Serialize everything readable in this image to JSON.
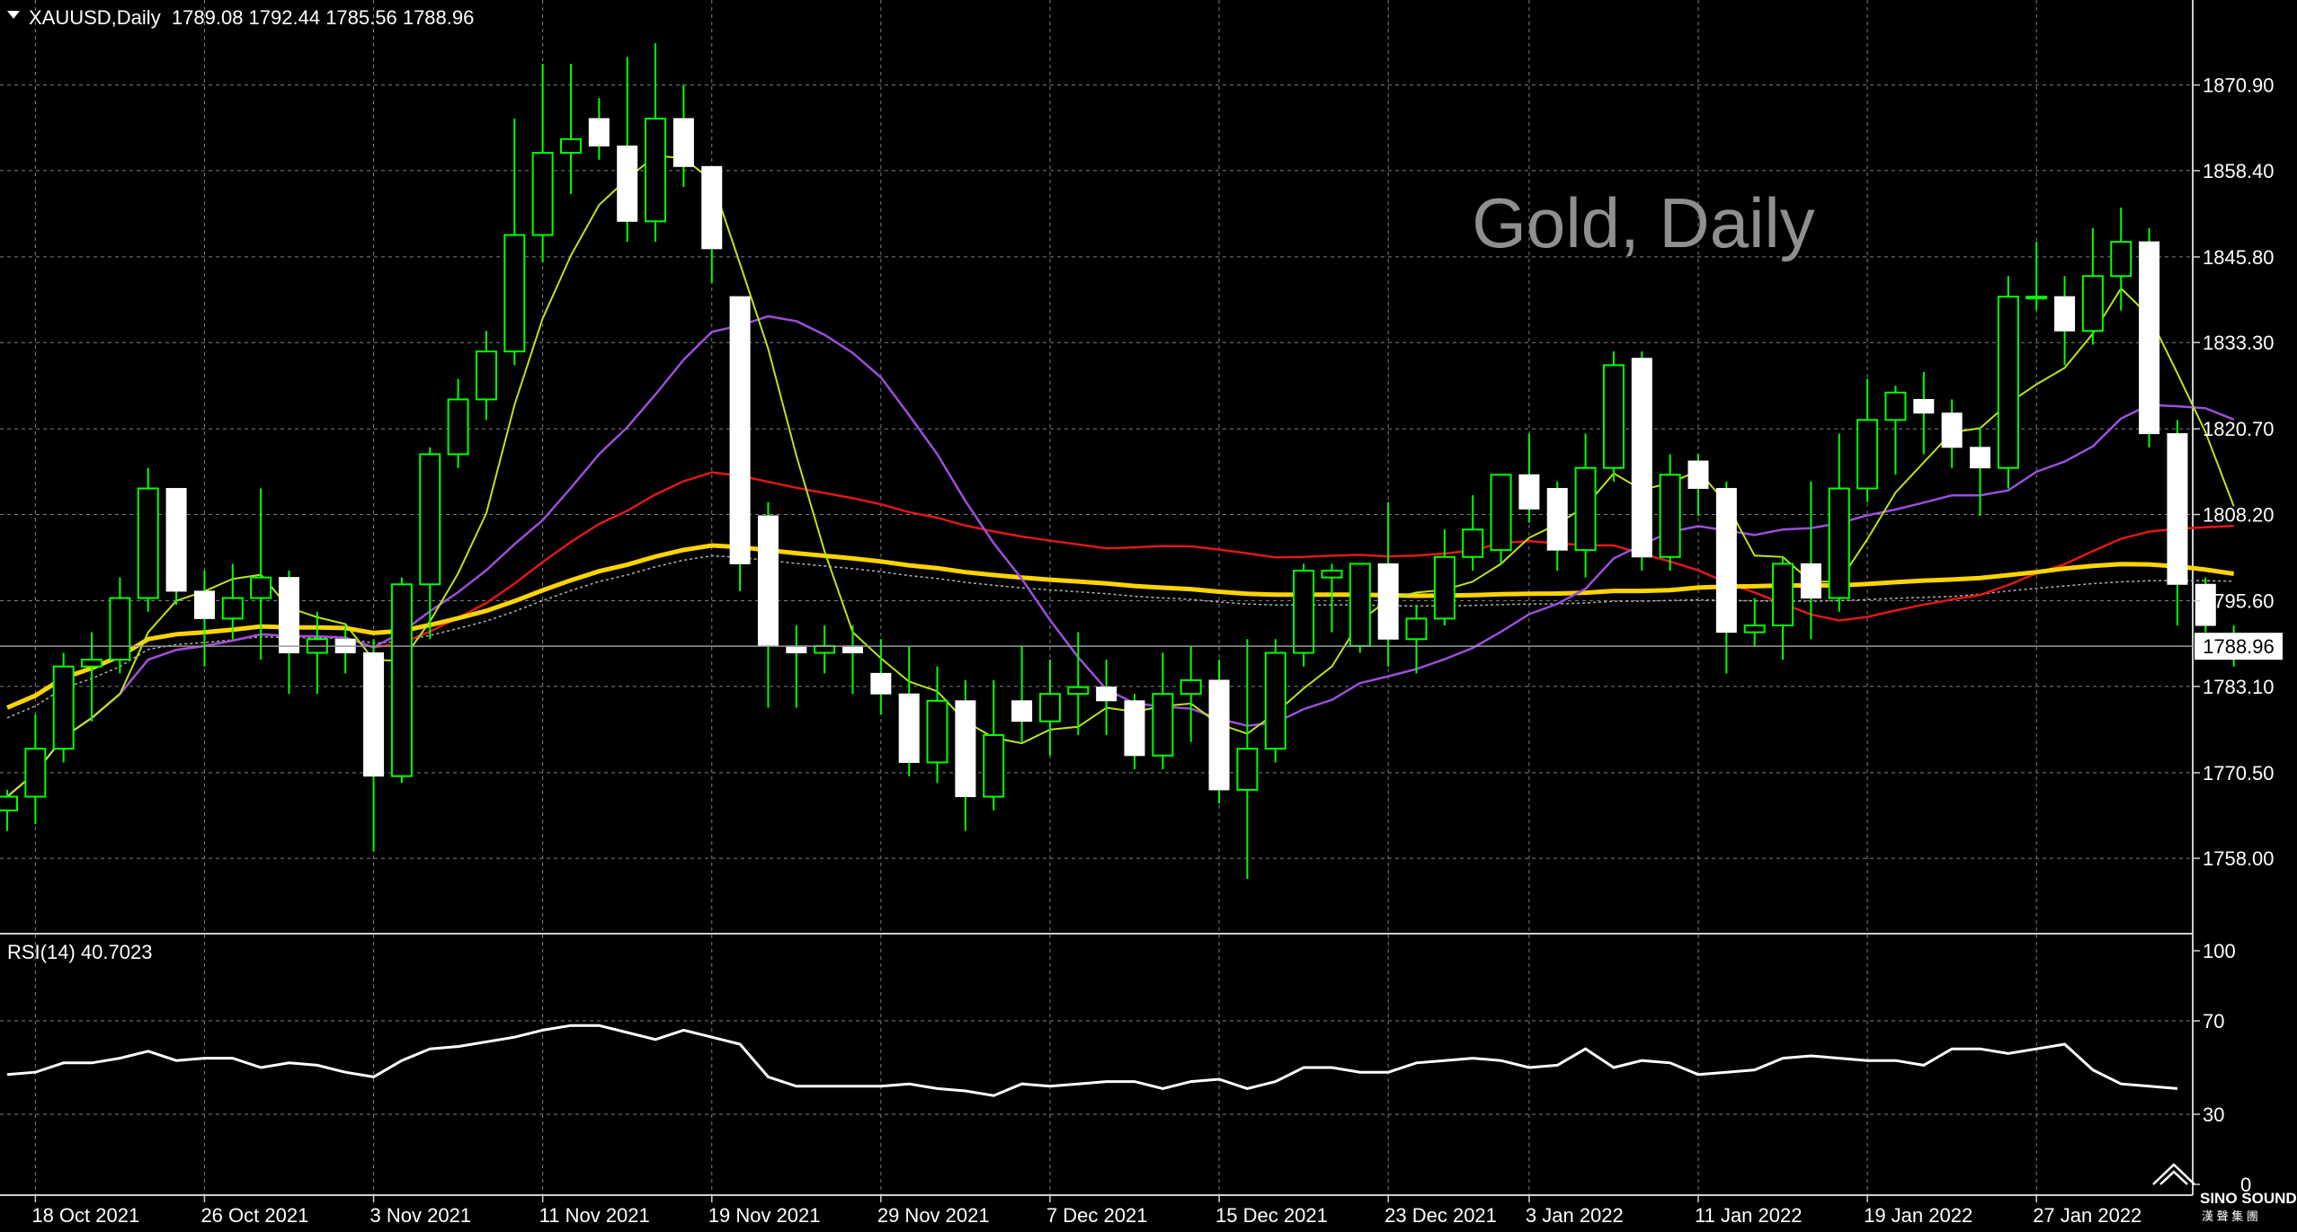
{
  "header": {
    "symbol_line": "XAUUSD,Daily  1789.08 1792.44 1785.56 1788.96",
    "watermark": "Gold, Daily"
  },
  "price_label": "1788.96",
  "rsi_label": "RSI(14) 40.7023",
  "logo": {
    "line1": "SINO SOUND",
    "line2": "漢 聲 集 團"
  },
  "colors": {
    "background": "#000000",
    "grid": "#7f7f7f",
    "bull_candle": "#00ff00",
    "bear_candle": "#ffffff",
    "ma_fast": "#b7e51f",
    "ma_mid": "#9b4fdb",
    "ma_red": "#e01818",
    "ma_yellow": "#ffd400",
    "ma_grey": "#b0b0b0",
    "rsi_line": "#ffffff"
  },
  "chart_data": {
    "type": "candlestick",
    "symbol": "XAUUSD",
    "timeframe": "Daily",
    "last_ohlc": {
      "open": 1789.08,
      "high": 1792.44,
      "low": 1785.56,
      "close": 1788.96
    },
    "ylim": [
      1747.0,
      1882.0
    ],
    "y_ticks": [
      1758.0,
      1770.5,
      1783.1,
      1795.6,
      1808.2,
      1820.7,
      1833.3,
      1845.8,
      1858.4,
      1870.9
    ],
    "x_ticks": [
      {
        "label": "18 Oct 2021",
        "index": 1
      },
      {
        "label": "26 Oct 2021",
        "index": 7
      },
      {
        "label": "3 Nov 2021",
        "index": 13
      },
      {
        "label": "11 Nov 2021",
        "index": 19
      },
      {
        "label": "19 Nov 2021",
        "index": 25
      },
      {
        "label": "29 Nov 2021",
        "index": 31
      },
      {
        "label": "7 Dec 2021",
        "index": 37
      },
      {
        "label": "15 Dec 2021",
        "index": 43
      },
      {
        "label": "23 Dec 2021",
        "index": 49
      },
      {
        "label": "3 Jan 2022",
        "index": 54
      },
      {
        "label": "11 Jan 2022",
        "index": 60
      },
      {
        "label": "19 Jan 2022",
        "index": 66
      },
      {
        "label": "27 Jan 2022",
        "index": 72
      }
    ],
    "candles": [
      [
        1765,
        1768,
        1762,
        1767
      ],
      [
        1767,
        1779,
        1763,
        1774
      ],
      [
        1774,
        1788,
        1772,
        1786
      ],
      [
        1786,
        1791,
        1778,
        1787
      ],
      [
        1787,
        1799,
        1785,
        1796
      ],
      [
        1796,
        1815,
        1794,
        1812
      ],
      [
        1812,
        1811,
        1795,
        1797
      ],
      [
        1797,
        1800,
        1786,
        1793
      ],
      [
        1793,
        1801,
        1790,
        1796
      ],
      [
        1796,
        1812,
        1787,
        1799
      ],
      [
        1799,
        1800,
        1782,
        1788
      ],
      [
        1788,
        1794,
        1782,
        1790
      ],
      [
        1790,
        1792,
        1785,
        1788
      ],
      [
        1788,
        1790,
        1759,
        1770
      ],
      [
        1770,
        1799,
        1769,
        1798
      ],
      [
        1798,
        1818,
        1790,
        1817
      ],
      [
        1817,
        1828,
        1815,
        1825
      ],
      [
        1825,
        1835,
        1822,
        1832
      ],
      [
        1832,
        1866,
        1830,
        1849
      ],
      [
        1849,
        1874,
        1845,
        1861
      ],
      [
        1861,
        1874,
        1855,
        1863
      ],
      [
        1866,
        1869,
        1860,
        1862
      ],
      [
        1862,
        1875,
        1848,
        1851
      ],
      [
        1851,
        1877,
        1848,
        1866
      ],
      [
        1866,
        1871,
        1856,
        1859
      ],
      [
        1859,
        1857,
        1842,
        1847
      ],
      [
        1840,
        1839,
        1797,
        1801
      ],
      [
        1808,
        1810,
        1780,
        1789
      ],
      [
        1789,
        1792,
        1780,
        1788
      ],
      [
        1788,
        1792,
        1785,
        1789
      ],
      [
        1789,
        1792,
        1782,
        1788
      ],
      [
        1785,
        1790,
        1779,
        1782
      ],
      [
        1782,
        1789,
        1770,
        1772
      ],
      [
        1772,
        1786,
        1769,
        1781
      ],
      [
        1781,
        1784,
        1762,
        1767
      ],
      [
        1767,
        1784,
        1765,
        1776
      ],
      [
        1781,
        1789,
        1775,
        1778
      ],
      [
        1778,
        1787,
        1773,
        1782
      ],
      [
        1782,
        1791,
        1776,
        1783
      ],
      [
        1783,
        1787,
        1776,
        1781
      ],
      [
        1781,
        1782,
        1771,
        1773
      ],
      [
        1773,
        1788,
        1771,
        1782
      ],
      [
        1782,
        1789,
        1775,
        1784
      ],
      [
        1784,
        1787,
        1766,
        1768
      ],
      [
        1768,
        1790,
        1755,
        1774
      ],
      [
        1774,
        1790,
        1772,
        1788
      ],
      [
        1788,
        1801,
        1786,
        1800
      ],
      [
        1799,
        1801,
        1791,
        1800
      ],
      [
        1789,
        1801,
        1788,
        1801
      ],
      [
        1801,
        1810,
        1786,
        1790
      ],
      [
        1790,
        1795,
        1785,
        1793
      ],
      [
        1793,
        1806,
        1792,
        1802
      ],
      [
        1802,
        1811,
        1800,
        1806
      ],
      [
        1803,
        1812,
        1801,
        1814
      ],
      [
        1814,
        1820,
        1807,
        1809
      ],
      [
        1812,
        1813,
        1800,
        1803
      ],
      [
        1803,
        1820,
        1799,
        1815
      ],
      [
        1815,
        1832,
        1813,
        1830
      ],
      [
        1831,
        1832,
        1800,
        1802
      ],
      [
        1802,
        1817,
        1800,
        1814
      ],
      [
        1816,
        1817,
        1808,
        1812
      ],
      [
        1812,
        1813,
        1785,
        1791
      ],
      [
        1791,
        1796,
        1789,
        1792
      ],
      [
        1792,
        1802,
        1787,
        1801
      ],
      [
        1801,
        1813,
        1790,
        1796
      ],
      [
        1796,
        1820,
        1794,
        1812
      ],
      [
        1812,
        1828,
        1810,
        1822
      ],
      [
        1822,
        1827,
        1814,
        1826
      ],
      [
        1825,
        1829,
        1817,
        1823
      ],
      [
        1823,
        1825,
        1815,
        1818
      ],
      [
        1818,
        1821,
        1808,
        1815
      ],
      [
        1815,
        1843,
        1812,
        1840
      ],
      [
        1840,
        1848,
        1838,
        1840
      ],
      [
        1840,
        1843,
        1830,
        1835
      ],
      [
        1835,
        1850,
        1833,
        1843
      ],
      [
        1843,
        1853,
        1838,
        1848
      ],
      [
        1848,
        1850,
        1818,
        1820
      ],
      [
        1820,
        1822,
        1792,
        1798
      ],
      [
        1798,
        1799,
        1791,
        1792
      ],
      [
        1789,
        1792,
        1786,
        1789
      ]
    ],
    "rsi": {
      "period": 14,
      "value": 40.7023,
      "ylim": [
        0,
        100
      ],
      "y_ticks": [
        0,
        30,
        70,
        100
      ],
      "values": [
        47,
        48,
        52,
        52,
        54,
        57,
        53,
        54,
        54,
        50,
        52,
        51,
        48,
        46,
        53,
        58,
        59,
        61,
        63,
        66,
        68,
        68,
        65,
        62,
        66,
        63,
        60,
        46,
        42,
        42,
        42,
        42,
        43,
        41,
        40,
        38,
        43,
        42,
        43,
        44,
        44,
        41,
        44,
        45,
        41,
        44,
        50,
        50,
        48,
        48,
        52,
        53,
        54,
        53,
        50,
        51,
        58,
        50,
        53,
        52,
        47,
        48,
        49,
        54,
        55,
        54,
        53,
        53,
        51,
        58,
        58,
        56,
        58,
        60,
        49,
        43,
        42,
        41
      ]
    }
  }
}
